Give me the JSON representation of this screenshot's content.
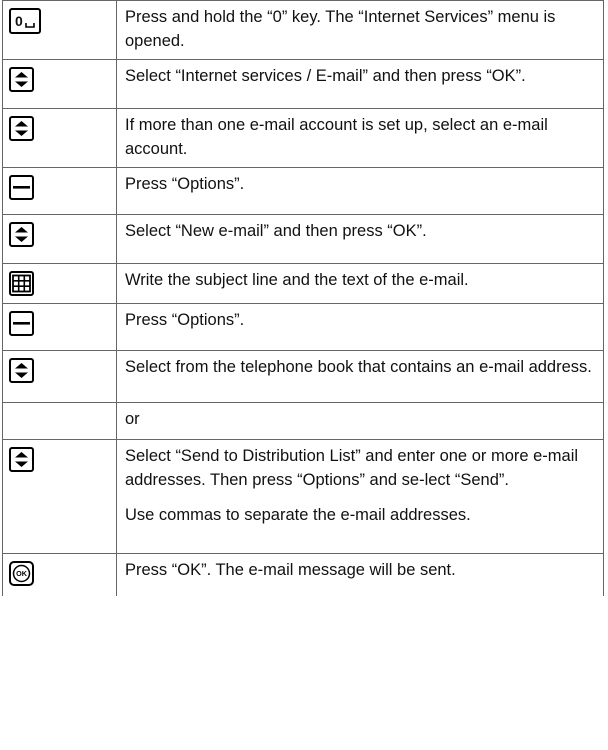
{
  "steps": [
    {
      "icon": "zero-key-icon",
      "key_label": "0",
      "text": [
        "Press and hold the “0” key. The “Internet Services” menu is opened."
      ]
    },
    {
      "icon": "navigation-up-down-key-icon",
      "text": [
        "Select “Internet services / E-mail” and then press “OK”."
      ]
    },
    {
      "icon": "navigation-up-down-key-icon",
      "text": [
        "If more than one e-mail account is set up, select an e-mail account."
      ]
    },
    {
      "icon": "softkey-icon",
      "text": [
        "Press “Options”."
      ]
    },
    {
      "icon": "navigation-up-down-key-icon",
      "text": [
        "Select “New e-mail” and then press “OK”."
      ]
    },
    {
      "icon": "keypad-icon",
      "text": [
        "Write the subject line and the text of the e-mail."
      ]
    },
    {
      "icon": "softkey-icon",
      "text": [
        "Press “Options”."
      ]
    },
    {
      "icon": "navigation-up-down-key-icon",
      "text": [
        "Select from the telephone book that contains an e-mail address."
      ]
    },
    {
      "icon": "",
      "text": [
        "or"
      ]
    },
    {
      "icon": "navigation-up-down-key-icon",
      "text": [
        "Select “Send to Distribution List” and enter one or more e-mail addresses. Then press “Options” and se-lect “Send”.",
        "Use commas to separate the e-mail addresses."
      ]
    },
    {
      "icon": "ok-key-icon",
      "key_label": "OK",
      "text": [
        "Press “OK”. The e-mail message will be sent."
      ]
    }
  ]
}
